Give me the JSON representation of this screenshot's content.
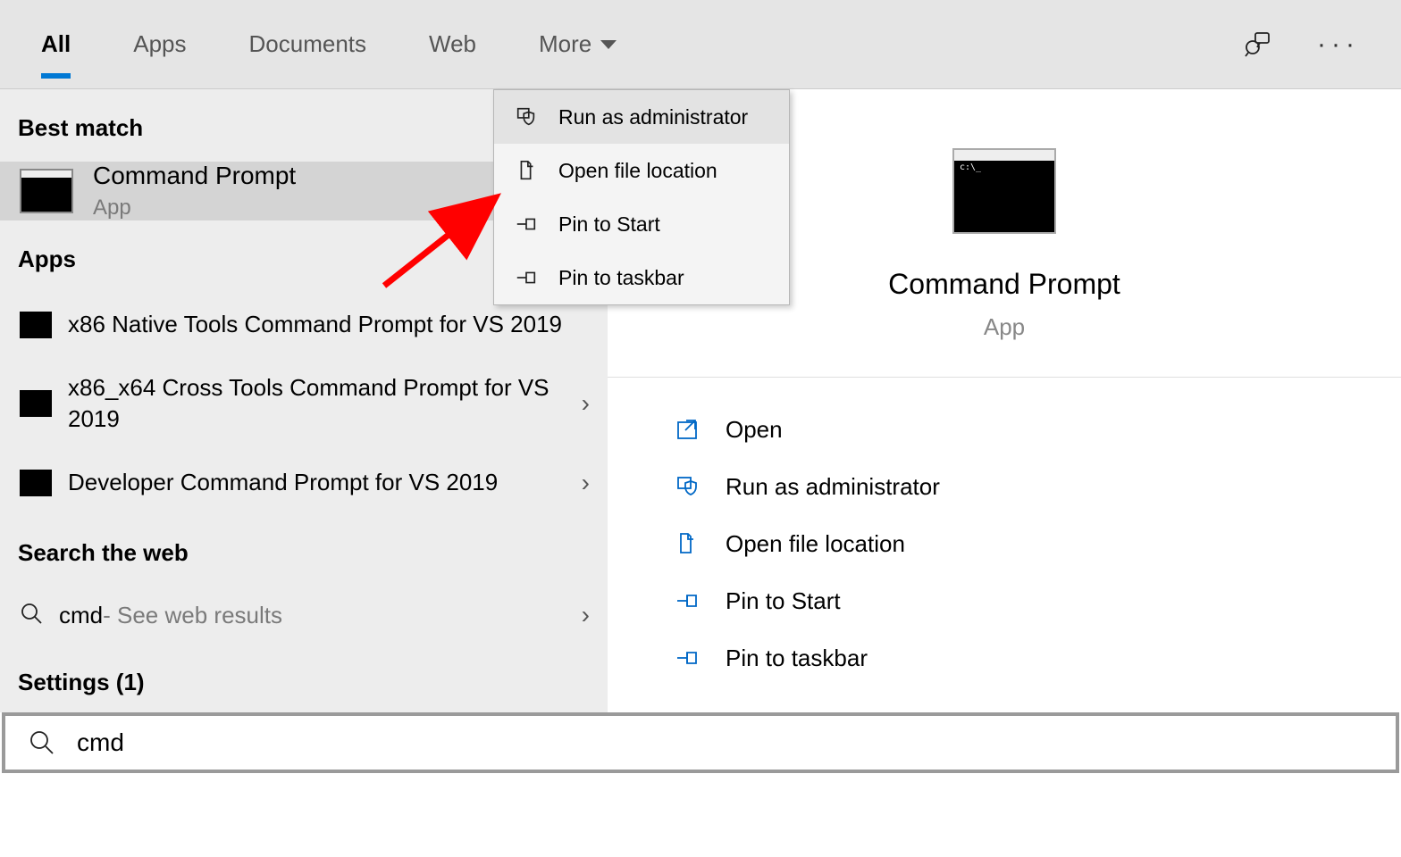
{
  "tabs": {
    "all": "All",
    "apps": "Apps",
    "documents": "Documents",
    "web": "Web",
    "more": "More"
  },
  "left": {
    "best_match_header": "Best match",
    "best_match": {
      "title": "Command Prompt",
      "subtitle": "App"
    },
    "apps_header": "Apps",
    "apps": [
      "x86 Native Tools Command Prompt for VS 2019",
      "x86_x64 Cross Tools Command Prompt for VS 2019",
      "Developer Command Prompt for VS 2019"
    ],
    "web_header": "Search the web",
    "web": {
      "term": "cmd",
      "suffix": " - See web results"
    },
    "settings_header": "Settings (1)"
  },
  "context": {
    "run_admin": "Run as administrator",
    "open_loc": "Open file location",
    "pin_start": "Pin to Start",
    "pin_task": "Pin to taskbar"
  },
  "right": {
    "title": "Command Prompt",
    "subtitle": "App",
    "actions": {
      "open": "Open",
      "run_admin": "Run as administrator",
      "open_loc": "Open file location",
      "pin_start": "Pin to Start",
      "pin_task": "Pin to taskbar"
    }
  },
  "search": {
    "value": "cmd"
  }
}
